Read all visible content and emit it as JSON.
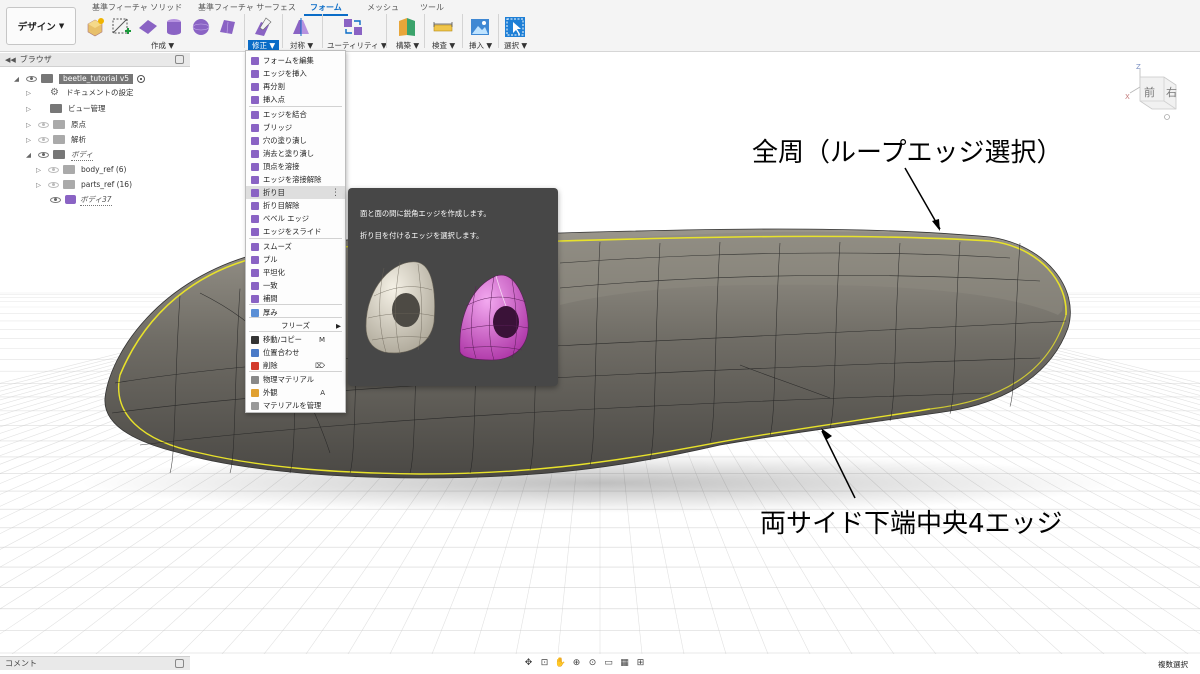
{
  "toolbar": {
    "workspace": "デザイン",
    "tabs": [
      {
        "label": "基準フィーチャ ソリッド"
      },
      {
        "label": "基準フィーチャ サーフェス"
      },
      {
        "label": "フォーム",
        "active": true
      },
      {
        "label": "メッシュ"
      },
      {
        "label": "ツール"
      }
    ],
    "groups": [
      {
        "label": "作成 ▼"
      },
      {
        "label": "修正 ▼",
        "active": true
      },
      {
        "label": "対称 ▼"
      },
      {
        "label": "ユーティリティ ▼"
      },
      {
        "label": "構築 ▼"
      },
      {
        "label": "検査 ▼"
      },
      {
        "label": "挿入 ▼"
      },
      {
        "label": "選択 ▼"
      }
    ]
  },
  "browser": {
    "title": "ブラウザ",
    "items": [
      {
        "label": "beetle_tutorial v5"
      },
      {
        "label": "ドキュメントの設定"
      },
      {
        "label": "ビュー管理"
      },
      {
        "label": "原点"
      },
      {
        "label": "解析"
      },
      {
        "label": "ボディ"
      },
      {
        "label": "body_ref (6)"
      },
      {
        "label": "parts_ref (16)"
      },
      {
        "label": "ボディ37"
      }
    ]
  },
  "menu": {
    "items": [
      {
        "label": "フォームを編集",
        "color": "#8a63c4"
      },
      {
        "label": "エッジを挿入",
        "color": "#8a63c4"
      },
      {
        "label": "再分割",
        "color": "#8a63c4"
      },
      {
        "label": "挿入点",
        "color": "#8a63c4"
      },
      {
        "label": "エッジを結合",
        "color": "#8a63c4"
      },
      {
        "label": "ブリッジ",
        "color": "#8a63c4"
      },
      {
        "label": "穴の塗り潰し",
        "color": "#8a63c4"
      },
      {
        "label": "消去と塗り潰し",
        "color": "#8a63c4"
      },
      {
        "label": "頂点を溶接",
        "color": "#8a63c4"
      },
      {
        "label": "エッジを溶接解除",
        "color": "#8a63c4"
      },
      {
        "label": "折り目",
        "color": "#8a63c4",
        "highlight": true
      },
      {
        "label": "折り目解除",
        "color": "#8a63c4"
      },
      {
        "label": "ベベル エッジ",
        "color": "#8a63c4"
      },
      {
        "label": "エッジをスライド",
        "color": "#8a63c4"
      },
      {
        "label": "スムーズ",
        "color": "#8a63c4"
      },
      {
        "label": "プル",
        "color": "#8a63c4"
      },
      {
        "label": "平坦化",
        "color": "#8a63c4"
      },
      {
        "label": "一致",
        "color": "#8a63c4"
      },
      {
        "label": "補間",
        "color": "#8a63c4"
      },
      {
        "label": "厚み",
        "color": "#5b8fd6"
      },
      {
        "label": "フリーズ"
      },
      {
        "label": "移動/コピー",
        "shortcut": "M",
        "color": "#333333"
      },
      {
        "label": "位置合わせ",
        "color": "#4a7ac7"
      },
      {
        "label": "削除",
        "shortcut": "⌦",
        "color": "#d33a2c"
      },
      {
        "label": "物理マテリアル",
        "color": "#888888"
      },
      {
        "label": "外観",
        "shortcut": "A",
        "color": "#e0a030"
      },
      {
        "label": "マテリアルを管理",
        "color": "#999999"
      }
    ]
  },
  "tooltip": {
    "line1": "面と面の間に鋭角エッジを作成します。",
    "line2": "折り目を付けるエッジを選択します。"
  },
  "viewport": {
    "annotation_top": "全周（ループエッジ選択）",
    "annotation_bottom": "両サイド下端中央4エッジ",
    "viewcube_front": "前",
    "viewcube_right": "右",
    "axis_z": "Z",
    "axis_x": "X"
  },
  "bottom": {
    "comments": "コメント",
    "status": "複数選択"
  }
}
